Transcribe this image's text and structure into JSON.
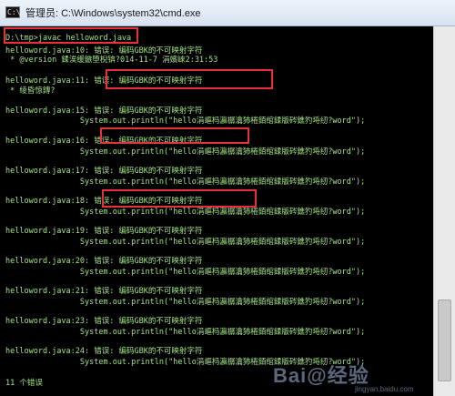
{
  "window": {
    "title": "管理员: C:\\Windows\\system32\\cmd.exe",
    "icon": "cmd-icon"
  },
  "console": {
    "lines": [
      "D:\\tmp>javac helloword.java",
      "helloword.java:10: 错误: 编码GBK的不可映射字符",
      " * @version 鍒涘缓鏃堕棿锛?014-11-7 涓嬪崍2:31:53",
      "helloword.java:11: 错误: 编码GBK的不可映射字符",
      " * 绫昏惊鏄?",
      "helloword.java:15: 错误: 编码GBK的不可映射字符",
      "                System.out.println(\"hello涓嶇杩瀛樼瀹犻棬銆绾鍒版硶鐎犳埓纫?word\");",
      "helloword.java:16: 错误: 编码GBK的不可映射字符",
      "                System.out.println(\"hello涓嶇杩瀛樼瀹犻棬銆绾鍒版硶鐎犳埓纫?word\");",
      "helloword.java:17: 错误: 编码GBK的不可映射字符",
      "                System.out.println(\"hello涓嶇杩瀛樼瀹犻棬銆绾鍒版硶鐎犳埓纫?word\");",
      "helloword.java:18: 错误: 编码GBK的不可映射字符",
      "                System.out.println(\"hello涓嶇杩瀛樼瀹犻棬銆绾鍒版硶鐎犳埓纫?word\");",
      "helloword.java:19: 错误: 编码GBK的不可映射字符",
      "                System.out.println(\"hello涓嶇杩瀛樼瀹犻棬銆绾鍒版硶鐎犳埓纫?word\");",
      "helloword.java:20: 错误: 编码GBK的不可映射字符",
      "                System.out.println(\"hello涓嶇杩瀛樼瀹犻棬銆绾鍒版硶鐎犳埓纫?word\");",
      "helloword.java:21: 错误: 编码GBK的不可映射字符",
      "                System.out.println(\"hello涓嶇杩瀛樼瀹犻棬銆绾鍒版硶鐎犳埓纫?word\");",
      "helloword.java:23: 错误: 编码GBK的不可映射字符",
      "                System.out.println(\"hello涓嶇杩瀛樼瀹犻棬銆绾鍒版硶鐎犳埓纫?word\");",
      "helloword.java:24: 错误: 编码GBK的不可映射字符",
      "                System.out.println(\"hello涓嶇杩瀛樼瀹犻棬銆绾鍒版硶鐎犳埓纫?word\");",
      "11 个错误"
    ]
  },
  "watermark": {
    "brand": "Bai@经验",
    "url": "jingyan.baidu.com"
  },
  "colors": {
    "console_text": "#a4e088",
    "highlight_box": "#e8303a",
    "background": "#000000"
  }
}
